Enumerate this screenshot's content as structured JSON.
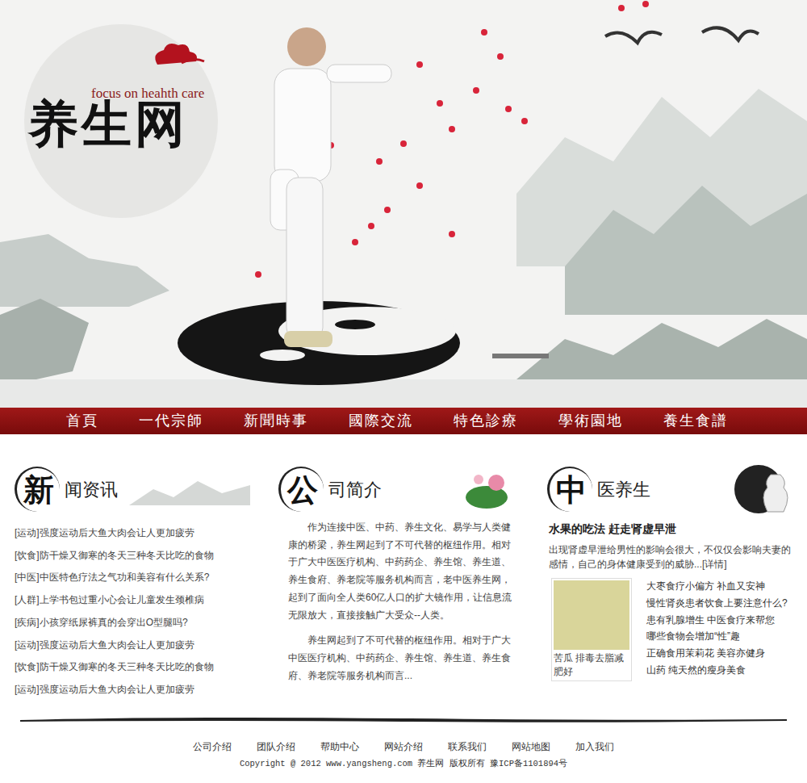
{
  "logo": {
    "title": "养生网",
    "slogan": "focus on heahth care"
  },
  "nav": [
    "首頁",
    "一代宗師",
    "新聞時事",
    "國際交流",
    "特色診療",
    "學術園地",
    "養生食譜"
  ],
  "news": {
    "heading": {
      "badge": "新",
      "rest": "闻资讯"
    },
    "items": [
      "[运动]强度运动后大鱼大肉会让人更加疲劳",
      "[饮食]防干燥又御寒的冬天三种冬天比吃的食物",
      "[中医]中医特色疗法之气功和美容有什么关系?",
      "[人群]上学书包过重小心会让儿童发生颈椎病",
      "[疾病]小孩穿纸尿裤真的会穿出O型腿吗?",
      "[运动]强度运动后大鱼大肉会让人更加疲劳",
      "[饮食]防干燥又御寒的冬天三种冬天比吃的食物",
      "[运动]强度运动后大鱼大肉会让人更加疲劳"
    ]
  },
  "about": {
    "heading": {
      "badge": "公",
      "rest": "司简介"
    },
    "paragraphs": [
      "作为连接中医、中药、养生文化、易学与人类健康的桥梁，养生网起到了不可代替的枢纽作用。相对于广大中医医疗机构、中药药企、养生馆、养生道、养生食府、养老院等服务机构而言，老中医养生网，起到了面向全人类60亿人口的扩大镜作用，让信息流无限放大，直接接触广大受众--人类。",
      "养生网起到了不可代替的枢纽作用。相对于广大中医医疗机构、中药药企、养生馆、养生道、养生食府、养老院等服务机构而言..."
    ]
  },
  "tcm": {
    "heading": {
      "badge": "中",
      "rest": "医养生"
    },
    "featured": {
      "title": "水果的吃法 赶走肾虚早泄",
      "summary": "出现肾虚早泄给男性的影响会很大，不仅仅会影响夫妻的感情，自己的身体健康受到的威胁...",
      "more": "[详情]"
    },
    "image_caption": "苦瓜 排毒去脂减肥好",
    "links": [
      "大枣食疗小偏方 补血又安神",
      "慢性肾炎患者饮食上要注意什么?",
      "患有乳腺增生 中医食疗来帮您",
      "哪些食物会增加“性”趣",
      "正确食用茉莉花 美容亦健身",
      "山药 纯天然的瘦身美食"
    ]
  },
  "footer": {
    "links": [
      "公司介绍",
      "团队介绍",
      "帮助中心",
      "网站介绍",
      "联系我们",
      "网站地图",
      "加入我们"
    ],
    "copyright": "Copyright @ 2012 www.yangsheng.com 养生网 版权所有 豫ICP备1101894号"
  }
}
